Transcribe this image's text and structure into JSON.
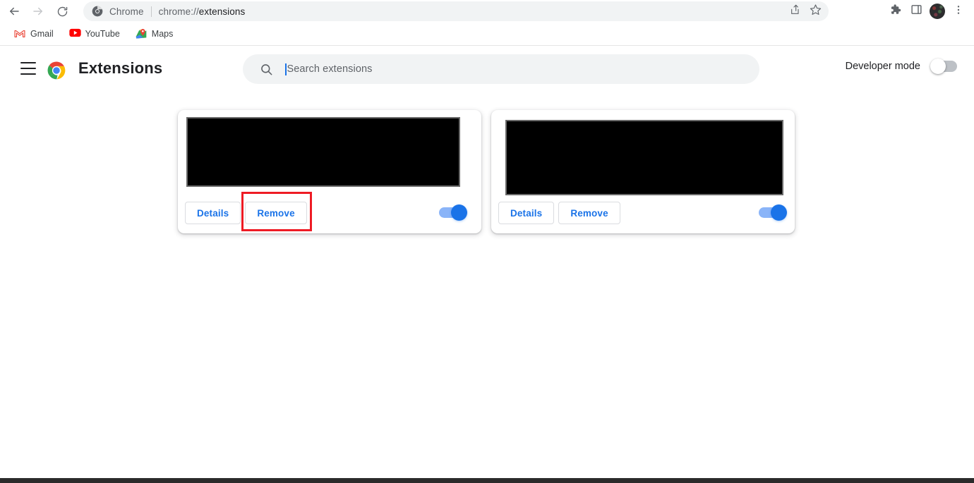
{
  "browser": {
    "nav": {
      "back_icon": "arrow-left-icon",
      "forward_icon": "arrow-right-icon",
      "reload_icon": "reload-icon"
    },
    "omnibox": {
      "site_icon": "chrome-icon",
      "site_label": "Chrome",
      "url_scheme": "chrome://",
      "url_path": "extensions",
      "share_icon": "share-icon",
      "bookmark_icon": "star-icon"
    },
    "toolbar_right": [
      {
        "name": "extensions-puzzle-icon",
        "label": "Extensions"
      },
      {
        "name": "side-panel-icon",
        "label": "Side panel"
      },
      {
        "name": "profile-avatar",
        "label": "Profile"
      },
      {
        "name": "chrome-menu-icon",
        "label": "Customize and control Google Chrome"
      }
    ],
    "bookmarks": [
      {
        "label": "Gmail",
        "icon": "gmail-icon"
      },
      {
        "label": "YouTube",
        "icon": "youtube-icon"
      },
      {
        "label": "Maps",
        "icon": "maps-icon"
      }
    ]
  },
  "page": {
    "menu_icon": "hamburger-menu-icon",
    "logo_icon": "chrome-logo-icon",
    "title": "Extensions",
    "search": {
      "icon": "search-icon",
      "placeholder": "Search extensions",
      "value": ""
    },
    "developer_mode": {
      "label": "Developer mode",
      "enabled": false
    },
    "cards": [
      {
        "name_redacted": "",
        "details_label": "Details",
        "remove_label": "Remove",
        "enabled": true
      },
      {
        "name_redacted": "",
        "details_label": "Details",
        "remove_label": "Remove",
        "enabled": true
      }
    ]
  },
  "annotation": {
    "highlight_target": "Remove",
    "highlight_color": "#ee1b24"
  }
}
